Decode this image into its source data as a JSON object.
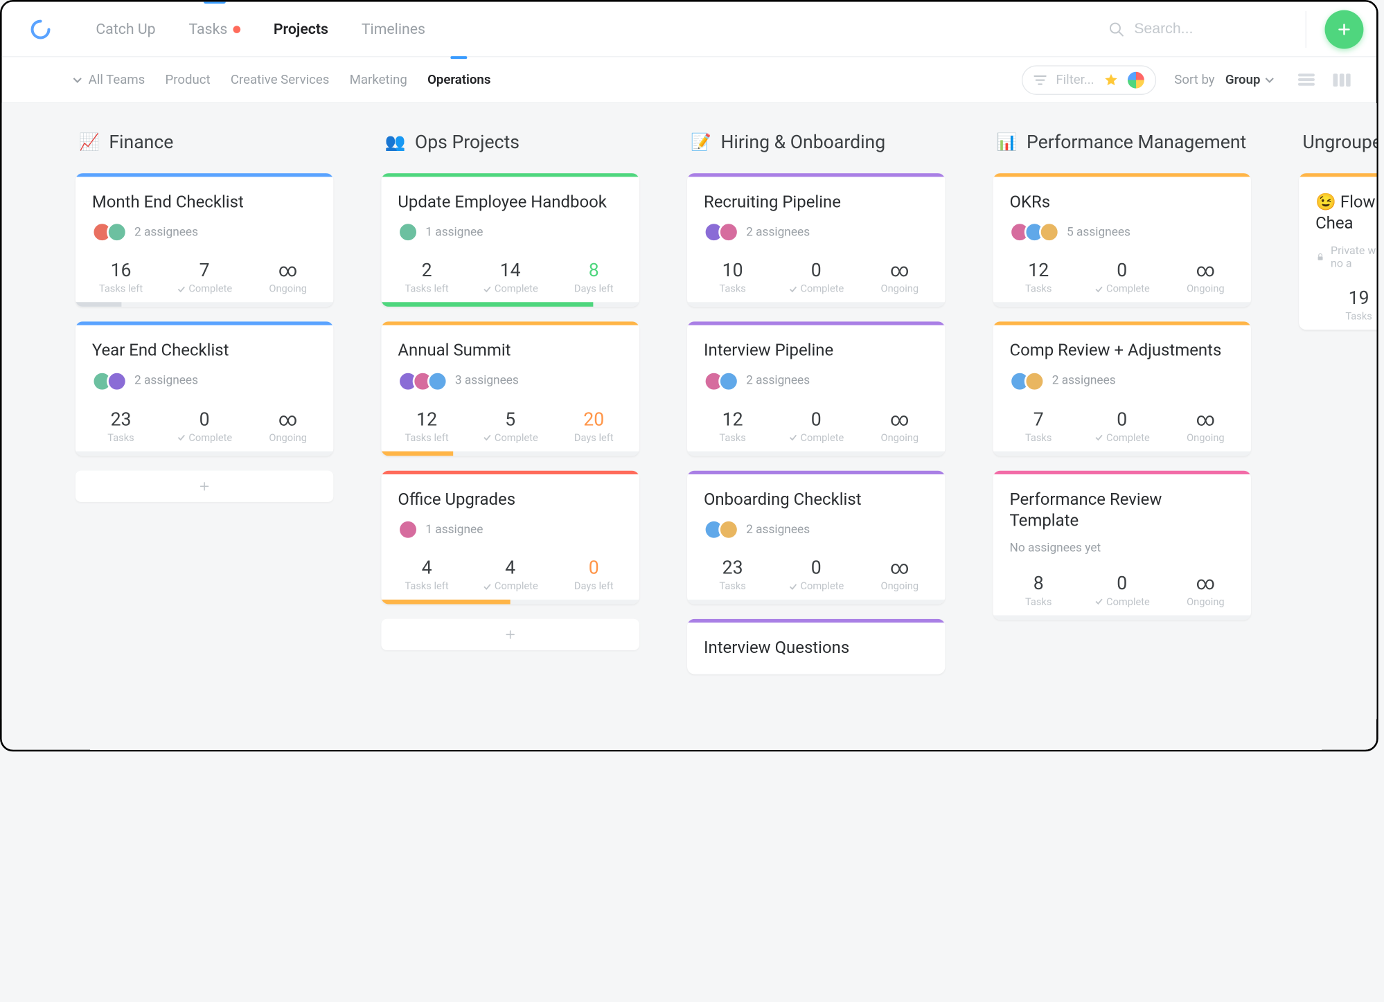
{
  "nav": {
    "items": [
      {
        "label": "Catch Up"
      },
      {
        "label": "Tasks"
      },
      {
        "label": "Projects"
      },
      {
        "label": "Timelines"
      }
    ],
    "search_placeholder": "Search..."
  },
  "subnav": {
    "all_teams": "All Teams",
    "tabs": [
      {
        "label": "Product"
      },
      {
        "label": "Creative Services"
      },
      {
        "label": "Marketing"
      },
      {
        "label": "Operations"
      }
    ],
    "filter_placeholder": "Filter...",
    "sort_label": "Sort by",
    "sort_value": "Group"
  },
  "labels": {
    "tasks_left": "Tasks left",
    "tasks": "Tasks",
    "complete": "Complete",
    "ongoing": "Ongoing",
    "days_left": "Days left",
    "assignee_sg": "1 assignee",
    "no_assignees": "No assignees yet",
    "private_no_a": "Private with no a"
  },
  "avatarColors": [
    "#e97060",
    "#6cc0a0",
    "#8a6cd6",
    "#d66c9e",
    "#60a8e9",
    "#e9b660"
  ],
  "accents": {
    "blue": "#5aa3ff",
    "green": "#4fd67e",
    "orange": "#ffb547",
    "red": "#ff6b5b",
    "purple": "#a97fe5",
    "pink": "#f26ca7"
  },
  "columns": [
    {
      "emoji": "📈",
      "title": "Finance",
      "cards": [
        {
          "title": "Month End Checklist",
          "accent": "blue",
          "assignees": 2,
          "assignee_text": "2 assignees",
          "stats": [
            {
              "value": "16",
              "label": "tasks_left"
            },
            {
              "value": "7",
              "label": "complete",
              "check": true
            },
            {
              "value": "∞",
              "label": "ongoing"
            }
          ],
          "progress": {
            "pct": 18,
            "color": "#d7dbe0"
          }
        },
        {
          "title": "Year End Checklist",
          "accent": "blue",
          "assignees": 2,
          "assignee_text": "2 assignees",
          "stats": [
            {
              "value": "23",
              "label": "tasks"
            },
            {
              "value": "0",
              "label": "complete",
              "check": true
            },
            {
              "value": "∞",
              "label": "ongoing"
            }
          ],
          "progress": {
            "pct": 0,
            "color": "#d7dbe0"
          }
        }
      ],
      "show_add": true
    },
    {
      "emoji": "👥",
      "title": "Ops Projects",
      "cards": [
        {
          "title": "Update Employee Handbook",
          "accent": "green",
          "assignees": 1,
          "assignee_text": "1 assignee",
          "stats": [
            {
              "value": "2",
              "label": "tasks_left"
            },
            {
              "value": "14",
              "label": "complete",
              "check": true
            },
            {
              "value": "8",
              "label": "days_left",
              "value_class": "green"
            }
          ],
          "progress": {
            "pct": 82,
            "color": "#4fd67e"
          }
        },
        {
          "title": "Annual Summit",
          "accent": "orange",
          "assignees": 3,
          "assignee_text": "3 assignees",
          "stats": [
            {
              "value": "12",
              "label": "tasks_left"
            },
            {
              "value": "5",
              "label": "complete",
              "check": true
            },
            {
              "value": "20",
              "label": "days_left",
              "value_class": "orange"
            }
          ],
          "progress": {
            "pct": 28,
            "color": "#ffb547"
          }
        },
        {
          "title": "Office Upgrades",
          "accent": "red",
          "assignees": 1,
          "assignee_text": "1 assignee",
          "stats": [
            {
              "value": "4",
              "label": "tasks_left"
            },
            {
              "value": "4",
              "label": "complete",
              "check": true
            },
            {
              "value": "0",
              "label": "days_left",
              "value_class": "orange"
            }
          ],
          "progress": {
            "pct": 50,
            "color": "#ffb547"
          }
        }
      ],
      "show_add": true
    },
    {
      "emoji": "📝",
      "title": "Hiring & Onboarding",
      "cards": [
        {
          "title": "Recruiting Pipeline",
          "accent": "purple",
          "assignees": 2,
          "assignee_text": "2 assignees",
          "stats": [
            {
              "value": "10",
              "label": "tasks"
            },
            {
              "value": "0",
              "label": "complete",
              "check": true
            },
            {
              "value": "∞",
              "label": "ongoing"
            }
          ],
          "progress": {
            "pct": 0,
            "color": "#d7dbe0"
          }
        },
        {
          "title": "Interview Pipeline",
          "accent": "purple",
          "assignees": 2,
          "assignee_text": "2 assignees",
          "stats": [
            {
              "value": "12",
              "label": "tasks"
            },
            {
              "value": "0",
              "label": "complete",
              "check": true
            },
            {
              "value": "∞",
              "label": "ongoing"
            }
          ],
          "progress": {
            "pct": 0,
            "color": "#d7dbe0"
          }
        },
        {
          "title": "Onboarding Checklist",
          "accent": "purple",
          "assignees": 2,
          "assignee_text": "2 assignees",
          "stats": [
            {
              "value": "23",
              "label": "tasks"
            },
            {
              "value": "0",
              "label": "complete",
              "check": true
            },
            {
              "value": "∞",
              "label": "ongoing"
            }
          ],
          "progress": {
            "pct": 0,
            "color": "#d7dbe0"
          }
        },
        {
          "title": "Interview Questions",
          "accent": "purple",
          "assignees": 0,
          "partial_title_only": true
        }
      ],
      "show_add": false
    },
    {
      "emoji": "📊",
      "title": "Performance Management",
      "cards": [
        {
          "title": "OKRs",
          "accent": "orange",
          "assignees": 5,
          "assignee_text": "5 assignees",
          "stats": [
            {
              "value": "12",
              "label": "tasks"
            },
            {
              "value": "0",
              "label": "complete",
              "check": true
            },
            {
              "value": "∞",
              "label": "ongoing"
            }
          ],
          "progress": {
            "pct": 0,
            "color": "#d7dbe0"
          }
        },
        {
          "title": "Comp Review + Adjustments",
          "accent": "orange",
          "assignees": 2,
          "assignee_text": "2 assignees",
          "stats": [
            {
              "value": "7",
              "label": "tasks"
            },
            {
              "value": "0",
              "label": "complete",
              "check": true
            },
            {
              "value": "∞",
              "label": "ongoing"
            }
          ],
          "progress": {
            "pct": 0,
            "color": "#d7dbe0"
          }
        },
        {
          "title": "Performance Review Template",
          "accent": "pink",
          "assignees": 0,
          "assignee_text_key": "no_assignees",
          "stats": [
            {
              "value": "8",
              "label": "tasks"
            },
            {
              "value": "0",
              "label": "complete",
              "check": true
            },
            {
              "value": "∞",
              "label": "ongoing"
            }
          ],
          "progress": {
            "pct": 0,
            "color": "#d7dbe0"
          }
        }
      ],
      "show_add": false
    },
    {
      "emoji": "",
      "title": "Ungrouped",
      "ungrouped": true,
      "cards": [
        {
          "title": "Flow Chea",
          "emoji": "😉",
          "accent": "orange",
          "private": true,
          "stats": [
            {
              "value": "19",
              "label": "tasks"
            }
          ],
          "partial": true
        }
      ],
      "show_add": false
    }
  ]
}
